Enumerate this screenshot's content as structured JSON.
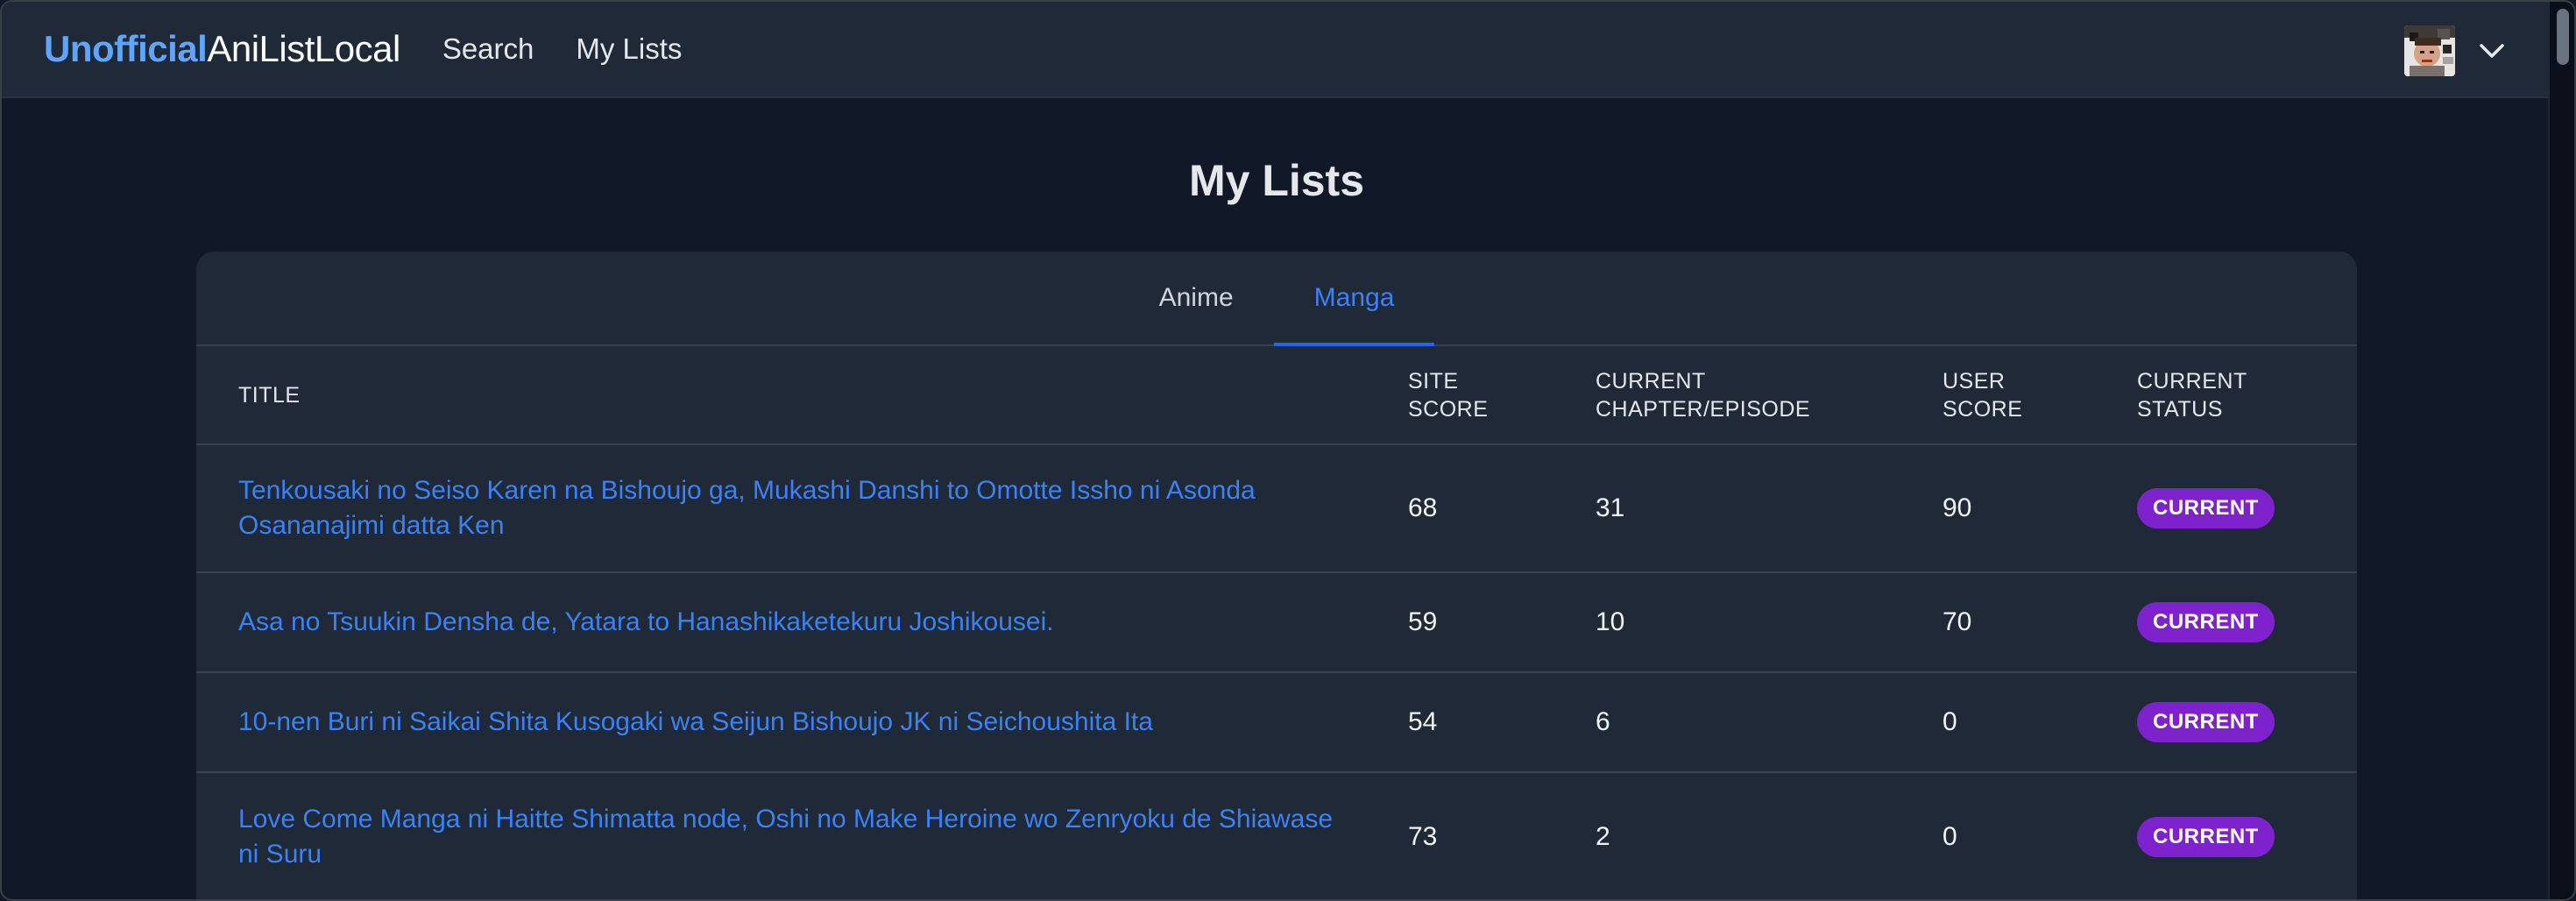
{
  "nav": {
    "brand_part1": "Unofficial",
    "brand_part2": "AniListLocal",
    "links": [
      "Search",
      "My Lists"
    ]
  },
  "page": {
    "title": "My Lists"
  },
  "tabs": [
    {
      "label": "Anime",
      "active": false
    },
    {
      "label": "Manga",
      "active": true
    }
  ],
  "table": {
    "headers": {
      "title": "TITLE",
      "site_score": [
        "SITE",
        "SCORE"
      ],
      "progress": [
        "CURRENT",
        "CHAPTER/EPISODE"
      ],
      "user_score": [
        "USER",
        "SCORE"
      ],
      "status": [
        "CURRENT",
        "STATUS"
      ]
    },
    "rows": [
      {
        "title_line1": "Tenkousaki no Seiso Karen na Bishoujo ga, Mukashi Danshi to Omotte Issho ni Asonda",
        "title_line2": "Osananajimi datta Ken",
        "site_score": "68",
        "progress": "31",
        "user_score": "90",
        "status": "CURRENT"
      },
      {
        "title_line1": "Asa no Tsuukin Densha de, Yatara to Hanashikaketekuru Joshikousei.",
        "title_line2": "",
        "site_score": "59",
        "progress": "10",
        "user_score": "70",
        "status": "CURRENT"
      },
      {
        "title_line1": "10-nen Buri ni Saikai Shita Kusogaki wa Seijun Bishoujo JK ni Seichoushita Ita",
        "title_line2": "",
        "site_score": "54",
        "progress": "6",
        "user_score": "0",
        "status": "CURRENT"
      },
      {
        "title_line1": "Love Come Manga ni Haitte Shimatta node, Oshi no Make Heroine wo Zenryoku de Shiawase",
        "title_line2": "ni Suru",
        "site_score": "73",
        "progress": "2",
        "user_score": "0",
        "status": "CURRENT"
      }
    ]
  },
  "colors": {
    "accent": "#3b82f6",
    "status_badge": "#7e22ce",
    "background": "#111827",
    "surface": "#1f2937"
  },
  "icons": {
    "chevron": "chevron-down-icon",
    "avatar": "user-avatar"
  }
}
